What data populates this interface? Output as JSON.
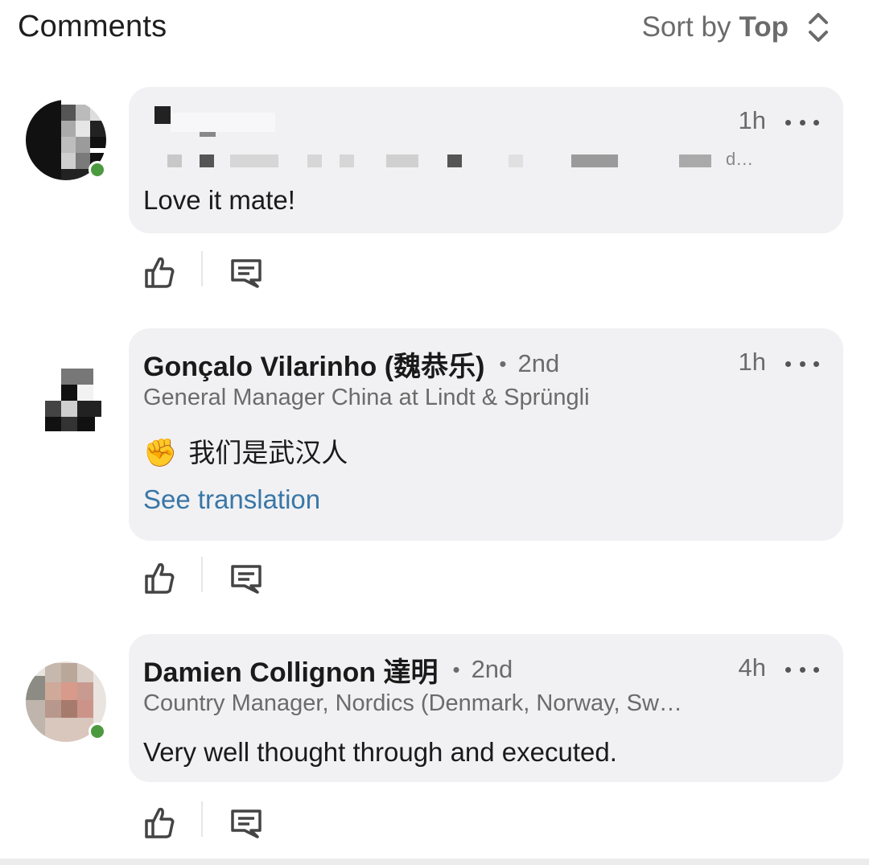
{
  "header": {
    "title": "Comments",
    "sort_prefix": "Sort by",
    "sort_value": "Top"
  },
  "comments": [
    {
      "author": "",
      "degree": "",
      "time": "1h",
      "headline": "",
      "text": "Love it mate!",
      "avatar_blurred": true,
      "online": true
    },
    {
      "author": "Gonçalo Vilarinho (魏恭乐)",
      "separator": "•",
      "degree": "2nd",
      "time": "1h",
      "headline": "General Manager China at Lindt & Sprüngli",
      "emoji": "✊",
      "text": "我们是武汉人",
      "translation_link": "See translation",
      "avatar_blurred": true,
      "online": false
    },
    {
      "author": "Damien Collignon 達明",
      "separator": "•",
      "degree": "2nd",
      "time": "4h",
      "headline": "Country Manager, Nordics (Denmark, Norway, Sw…",
      "text": "Very well thought through and executed.",
      "avatar_blurred": true,
      "online": true
    }
  ],
  "icons": {
    "like": "thumbs-up-icon",
    "reply": "reply-icon",
    "more": "more-icon",
    "sort": "sort-updown-icon"
  },
  "colors": {
    "bubble": "#f1f1f3",
    "link": "#3877a7",
    "presence": "#4c9a3f",
    "muted": "#6b6b6b"
  }
}
